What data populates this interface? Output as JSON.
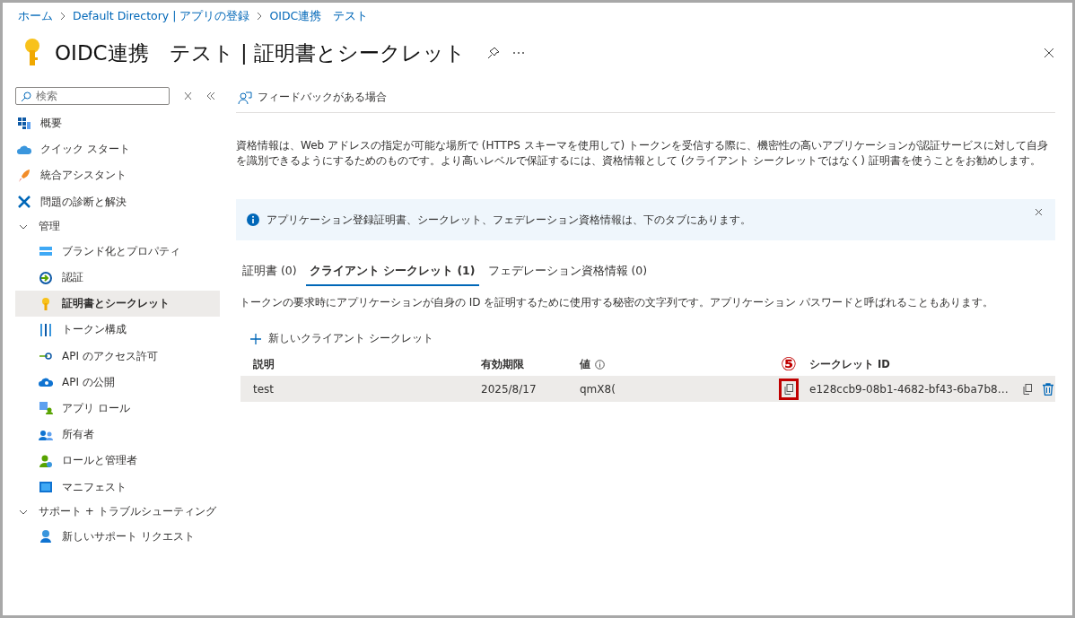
{
  "breadcrumb": [
    "ホーム",
    "Default Directory | アプリの登録",
    "OIDC連携　テスト"
  ],
  "title": "OIDC連携　テスト | 証明書とシークレット",
  "sidebar": {
    "search": {
      "placeholder": "検索"
    },
    "items": [
      {
        "kind": "item",
        "label": "概要",
        "selected": false
      },
      {
        "kind": "item",
        "label": "クイック スタート",
        "selected": false
      },
      {
        "kind": "item",
        "label": "統合アシスタント",
        "selected": false
      },
      {
        "kind": "item",
        "label": "問題の診断と解決",
        "selected": false
      },
      {
        "kind": "group",
        "label": "管理",
        "expanded": true,
        "children": [
          {
            "kind": "item",
            "label": "ブランド化とプロパティ",
            "selected": false
          },
          {
            "kind": "item",
            "label": "認証",
            "selected": false
          },
          {
            "kind": "item",
            "label": "証明書とシークレット",
            "selected": true
          },
          {
            "kind": "item",
            "label": "トークン構成",
            "selected": false
          },
          {
            "kind": "item",
            "label": "API のアクセス許可",
            "selected": false
          },
          {
            "kind": "item",
            "label": "API の公開",
            "selected": false
          },
          {
            "kind": "item",
            "label": "アプリ ロール",
            "selected": false
          },
          {
            "kind": "item",
            "label": "所有者",
            "selected": false
          },
          {
            "kind": "item",
            "label": "ロールと管理者",
            "selected": false
          },
          {
            "kind": "item",
            "label": "マニフェスト",
            "selected": false
          }
        ]
      },
      {
        "kind": "group",
        "label": "サポート + トラブルシューティング",
        "expanded": true,
        "children": [
          {
            "kind": "item",
            "label": "新しいサポート リクエスト",
            "selected": false
          }
        ]
      }
    ]
  },
  "toolbar": {
    "feedback": "フィードバックがある場合"
  },
  "description": "資格情報は、Web アドレスの指定が可能な場所で (HTTPS スキーマを使用して) トークンを受信する際に、機密性の高いアプリケーションが認証サービスに対して自身を識別できるようにするためのものです。より高いレベルで保証するには、資格情報として (クライアント シークレットではなく) 証明書を使うことをお勧めします。",
  "info_banner": "アプリケーション登録証明書、シークレット、フェデレーション資格情報は、下のタブにあります。",
  "tabs": [
    {
      "label": "証明書 (0)",
      "selected": false
    },
    {
      "label": "クライアント シークレット (1)",
      "selected": true
    },
    {
      "label": "フェデレーション資格情報 (0)",
      "selected": false
    }
  ],
  "tab_description": "トークンの要求時にアプリケーションが自身の ID を証明するために使用する秘密の文字列です。アプリケーション パスワードと呼ばれることもあります。",
  "new_secret_button": "新しいクライアント シークレット",
  "table": {
    "columns": [
      "説明",
      "有効期限",
      "値",
      "シークレット ID"
    ],
    "rows": [
      {
        "description": "test",
        "expires": "2025/8/17",
        "value": "qmX8(",
        "secret_id": "e128ccb9-08b1-4682-bf43-6ba7b8…",
        "highlighted": true
      }
    ]
  },
  "annotation": {
    "label": "⑤"
  }
}
